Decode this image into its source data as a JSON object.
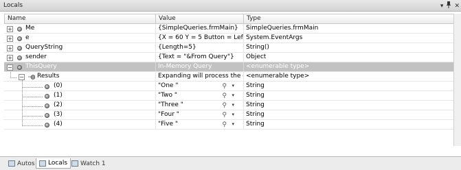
{
  "window": {
    "title": "Locals",
    "pin": "1",
    "close": "✕",
    "dropdown": "▾"
  },
  "columns": {
    "name": "Name",
    "value": "Value",
    "type": "Type"
  },
  "rows": [
    {
      "name": "Me",
      "value": "{SimpleQueries.frmMain}",
      "type": "SimpleQueries.frmMain",
      "expander": "+"
    },
    {
      "name": "e",
      "value": "{X = 60 Y = 5 Button = Left {",
      "type": "System.EventArgs",
      "expander": "+"
    },
    {
      "name": "QueryString",
      "value": "{Length=5}",
      "type": "String()",
      "expander": "+"
    },
    {
      "name": "sender",
      "value": "{Text = \"&From Query\"}",
      "type": "Object",
      "expander": "+"
    },
    {
      "name": "ThisQuery",
      "value": "In-Memory Query",
      "type": "<enumerable type>",
      "expander": "−"
    },
    {
      "name": "Results",
      "value": "Expanding will process the col",
      "type": "<enumerable type>",
      "expander": "−"
    },
    {
      "name": "(0)",
      "value": "\"One \"",
      "type": "String"
    },
    {
      "name": "(1)",
      "value": "\"Two \"",
      "type": "String"
    },
    {
      "name": "(2)",
      "value": "\"Three \"",
      "type": "String"
    },
    {
      "name": "(3)",
      "value": "\"Four \"",
      "type": "String"
    },
    {
      "name": "(4)",
      "value": "\"Five \"",
      "type": "String"
    }
  ],
  "icons": {
    "field": "field-icon",
    "results": "results-icon",
    "magnifier": "⚲",
    "dropdown": "▾"
  },
  "tabs": [
    {
      "label": "Autos",
      "active": false
    },
    {
      "label": "Locals",
      "active": true
    },
    {
      "label": "Watch 1",
      "active": false
    }
  ]
}
